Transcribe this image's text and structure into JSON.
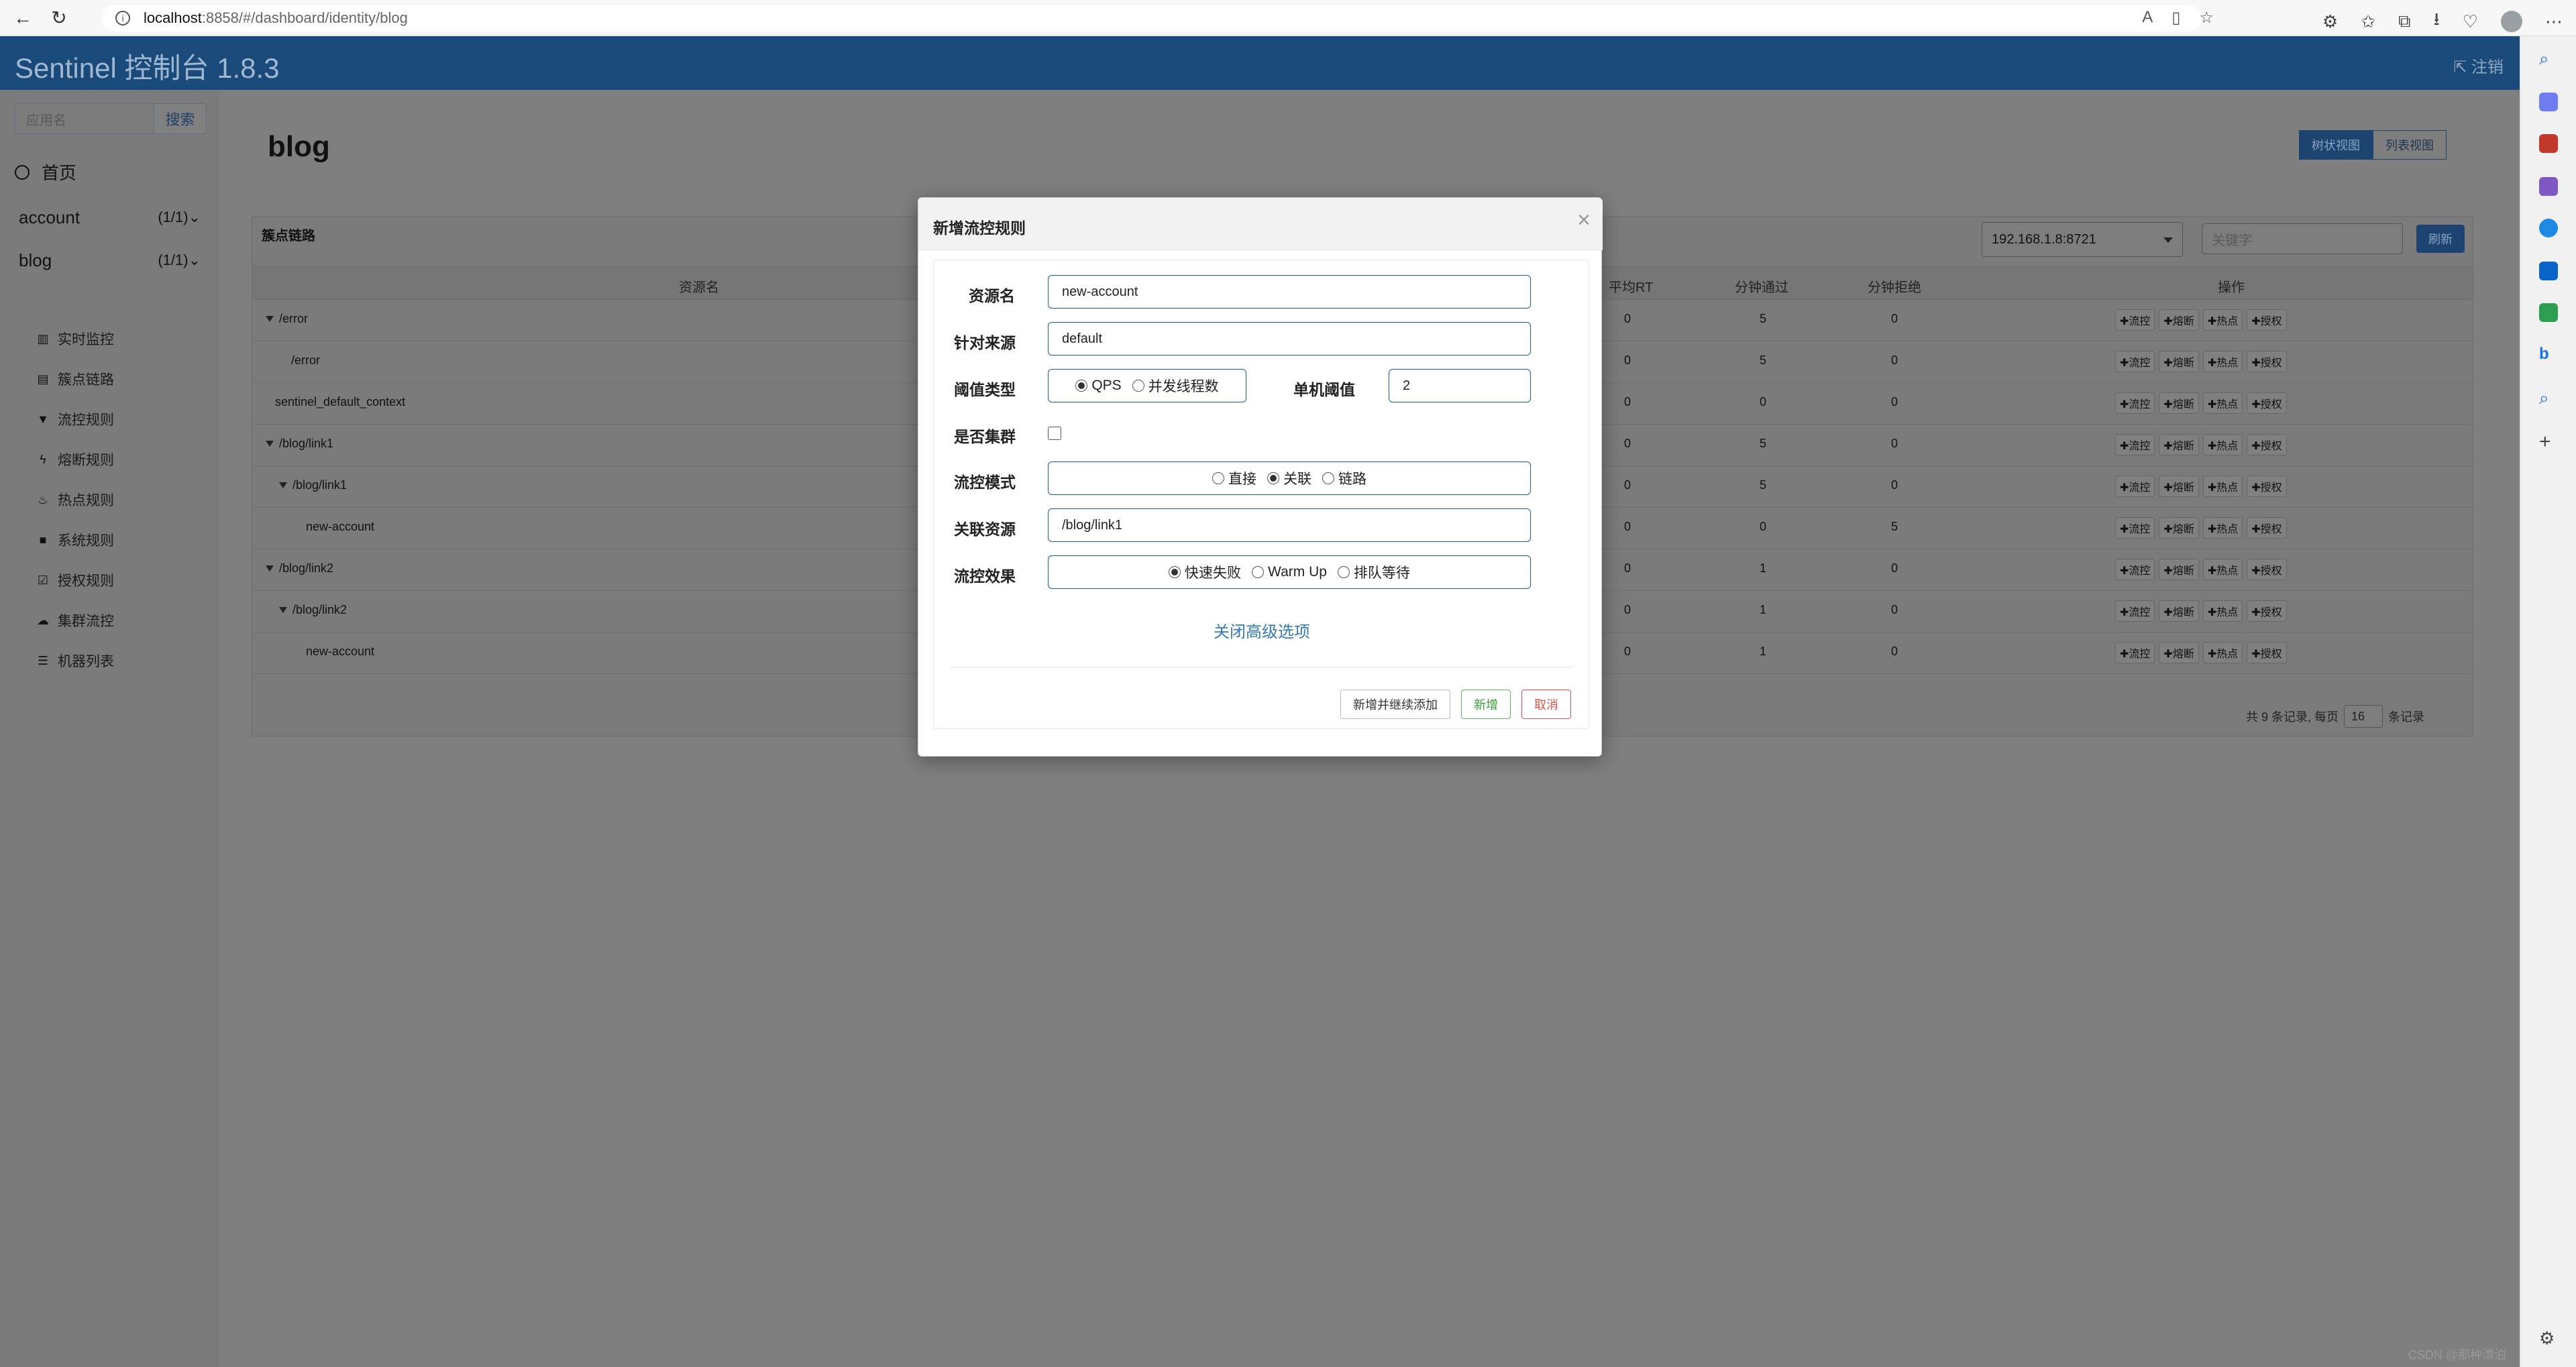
{
  "browser": {
    "url_host": "localhost",
    "url_path": ":8858/#/dashboard/identity/blog"
  },
  "app": {
    "brand": "Sentinel 控制台 1.8.3",
    "logout": "注销"
  },
  "sidebar": {
    "search_placeholder": "应用名",
    "search_button": "搜索",
    "home": "首页",
    "apps": [
      {
        "name": "account",
        "count": "(1/1)"
      },
      {
        "name": "blog",
        "count": "(1/1)"
      }
    ],
    "sub_items": [
      {
        "icon": "chart-icon",
        "glyph": "▥",
        "label": "实时监控"
      },
      {
        "icon": "table-icon",
        "glyph": "▤",
        "label": "簇点链路"
      },
      {
        "icon": "filter-icon",
        "glyph": "▼",
        "label": "流控规则"
      },
      {
        "icon": "bolt-icon",
        "glyph": "ϟ",
        "label": "熔断规则"
      },
      {
        "icon": "fire-icon",
        "glyph": "♨",
        "label": "热点规则"
      },
      {
        "icon": "lock-icon",
        "glyph": "■",
        "label": "系统规则"
      },
      {
        "icon": "check-square-icon",
        "glyph": "☑",
        "label": "授权规则"
      },
      {
        "icon": "cloud-icon",
        "glyph": "☁",
        "label": "集群流控"
      },
      {
        "icon": "list-icon",
        "glyph": "☰",
        "label": "机器列表"
      }
    ]
  },
  "page": {
    "title": "blog",
    "tree_view": "树状视图",
    "list_view": "列表视图",
    "panel_title": "簇点链路",
    "machine": "192.168.1.8:8721",
    "keyword_placeholder": "关键字",
    "refresh": "刷新",
    "columns": {
      "resource": "资源名",
      "avg_rt": "平均RT",
      "min_pass": "分钟通过",
      "min_block": "分钟拒绝",
      "ops": "操作"
    },
    "op_labels": [
      "✚流控",
      "✚熔断",
      "✚热点",
      "✚授权"
    ],
    "rows": [
      {
        "name": "/error",
        "expand": true,
        "indent": 0,
        "rt": "0",
        "pass": "5",
        "block": "0"
      },
      {
        "name": "/error",
        "expand": false,
        "indent": 1,
        "rt": "0",
        "pass": "5",
        "block": "0"
      },
      {
        "name": "sentinel_default_context",
        "expand": false,
        "indent": 0,
        "rt": "0",
        "pass": "0",
        "block": "0"
      },
      {
        "name": "/blog/link1",
        "expand": true,
        "indent": 0,
        "rt": "0",
        "pass": "5",
        "block": "0"
      },
      {
        "name": "/blog/link1",
        "expand": true,
        "indent": 1,
        "rt": "0",
        "pass": "5",
        "block": "0"
      },
      {
        "name": "new-account",
        "expand": false,
        "indent": 2,
        "rt": "0",
        "pass": "0",
        "block": "5"
      },
      {
        "name": "/blog/link2",
        "expand": true,
        "indent": 0,
        "rt": "0",
        "pass": "1",
        "block": "0"
      },
      {
        "name": "/blog/link2",
        "expand": true,
        "indent": 1,
        "rt": "0",
        "pass": "1",
        "block": "0"
      },
      {
        "name": "new-account",
        "expand": false,
        "indent": 2,
        "rt": "0",
        "pass": "1",
        "block": "0"
      }
    ],
    "footer_prefix": "共 9 条记录, 每页",
    "page_size": "16",
    "footer_suffix": "条记录"
  },
  "modal": {
    "title": "新增流控规则",
    "close": "×",
    "resource_label": "资源名",
    "resource_value": "new-account",
    "origin_label": "针对来源",
    "origin_value": "default",
    "threshold_type_label": "阈值类型",
    "threshold_type_options": [
      "QPS",
      "并发线程数"
    ],
    "threshold_type_selected": "QPS",
    "single_threshold_label": "单机阈值",
    "single_threshold_value": "2",
    "cluster_label": "是否集群",
    "cluster_checked": false,
    "mode_label": "流控模式",
    "mode_options": [
      "直接",
      "关联",
      "链路"
    ],
    "mode_selected": "关联",
    "ref_resource_label": "关联资源",
    "ref_resource_value": "/blog/link1",
    "effect_label": "流控效果",
    "effect_options": [
      "快速失败",
      "Warm Up",
      "排队等待"
    ],
    "effect_selected": "快速失败",
    "advanced_link": "关闭高级选项",
    "btn_add_continue": "新增并继续添加",
    "btn_add": "新增",
    "btn_cancel": "取消"
  },
  "watermark": "CSDN @那种漂泊"
}
